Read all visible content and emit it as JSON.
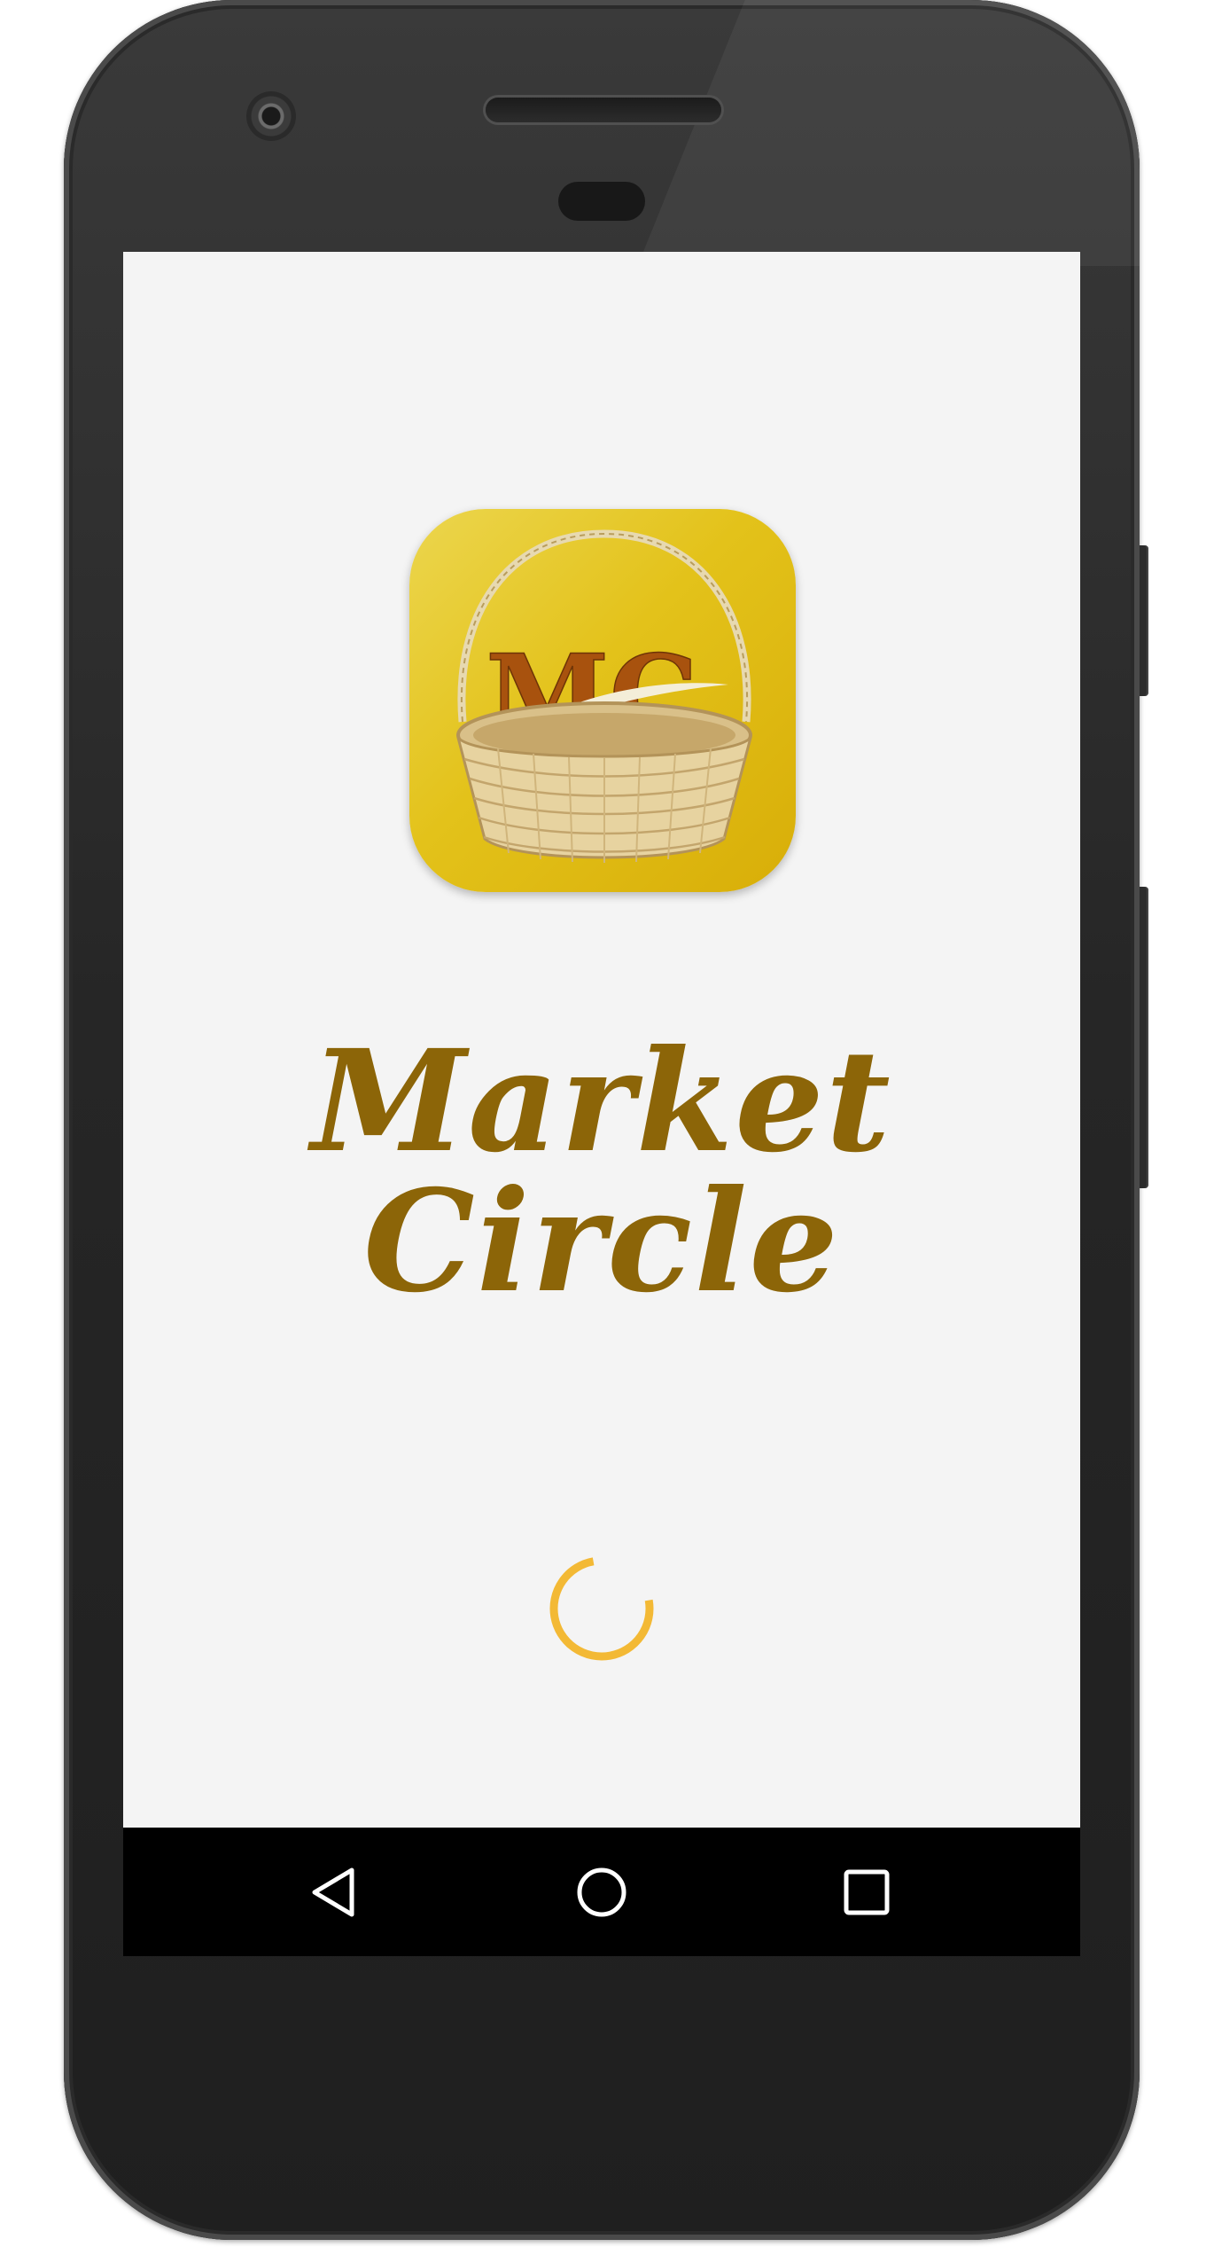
{
  "app": {
    "name": "Market Circle",
    "icon_monogram": "MC"
  },
  "colors": {
    "brand_gold": "#8c6508",
    "icon_yellow": "#e3c21a",
    "spinner": "#f3b935",
    "screen_background": "#f4f4f4",
    "nav_bar": "#000000"
  },
  "loading": {
    "indicator": "circular-progress-spinner"
  },
  "nav": {
    "icons": [
      "back-icon",
      "home-icon",
      "recents-icon"
    ]
  }
}
